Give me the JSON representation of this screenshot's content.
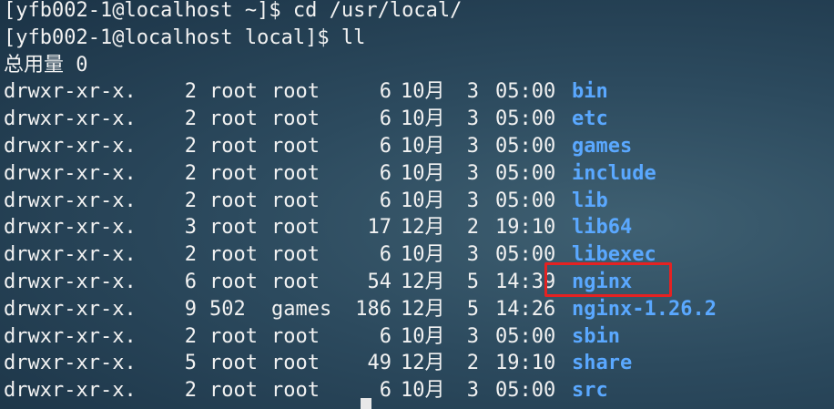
{
  "terminal": {
    "lines": [
      "[yfb002-1@localhost ~]$ cd /usr/local/",
      "[yfb002-1@localhost local]$ ll",
      "总用量 0"
    ],
    "listing": [
      {
        "perm": "drwxr-xr-x.",
        "links": "2",
        "owner": "root",
        "group": "root",
        "size": "6",
        "month": "10月",
        "day": "3",
        "time": "05:00",
        "name": "bin"
      },
      {
        "perm": "drwxr-xr-x.",
        "links": "2",
        "owner": "root",
        "group": "root",
        "size": "6",
        "month": "10月",
        "day": "3",
        "time": "05:00",
        "name": "etc"
      },
      {
        "perm": "drwxr-xr-x.",
        "links": "2",
        "owner": "root",
        "group": "root",
        "size": "6",
        "month": "10月",
        "day": "3",
        "time": "05:00",
        "name": "games"
      },
      {
        "perm": "drwxr-xr-x.",
        "links": "2",
        "owner": "root",
        "group": "root",
        "size": "6",
        "month": "10月",
        "day": "3",
        "time": "05:00",
        "name": "include"
      },
      {
        "perm": "drwxr-xr-x.",
        "links": "2",
        "owner": "root",
        "group": "root",
        "size": "6",
        "month": "10月",
        "day": "3",
        "time": "05:00",
        "name": "lib"
      },
      {
        "perm": "drwxr-xr-x.",
        "links": "3",
        "owner": "root",
        "group": "root",
        "size": "17",
        "month": "12月",
        "day": "2",
        "time": "19:10",
        "name": "lib64"
      },
      {
        "perm": "drwxr-xr-x.",
        "links": "2",
        "owner": "root",
        "group": "root",
        "size": "6",
        "month": "10月",
        "day": "3",
        "time": "05:00",
        "name": "libexec"
      },
      {
        "perm": "drwxr-xr-x.",
        "links": "6",
        "owner": "root",
        "group": "root",
        "size": "54",
        "month": "12月",
        "day": "5",
        "time": "14:39",
        "name": "nginx"
      },
      {
        "perm": "drwxr-xr-x.",
        "links": "9",
        "owner": "502",
        "group": "games",
        "size": "186",
        "month": "12月",
        "day": "5",
        "time": "14:26",
        "name": "nginx-1.26.2"
      },
      {
        "perm": "drwxr-xr-x.",
        "links": "2",
        "owner": "root",
        "group": "root",
        "size": "6",
        "month": "10月",
        "day": "3",
        "time": "05:00",
        "name": "sbin"
      },
      {
        "perm": "drwxr-xr-x.",
        "links": "5",
        "owner": "root",
        "group": "root",
        "size": "49",
        "month": "12月",
        "day": "2",
        "time": "19:10",
        "name": "share"
      },
      {
        "perm": "drwxr-xr-x.",
        "links": "2",
        "owner": "root",
        "group": "root",
        "size": "6",
        "month": "10月",
        "day": "3",
        "time": "05:00",
        "name": "src"
      }
    ],
    "highlight_color": "#e52222",
    "dir_color": "#5aa8ff",
    "background_color": "#2c4a5e"
  }
}
